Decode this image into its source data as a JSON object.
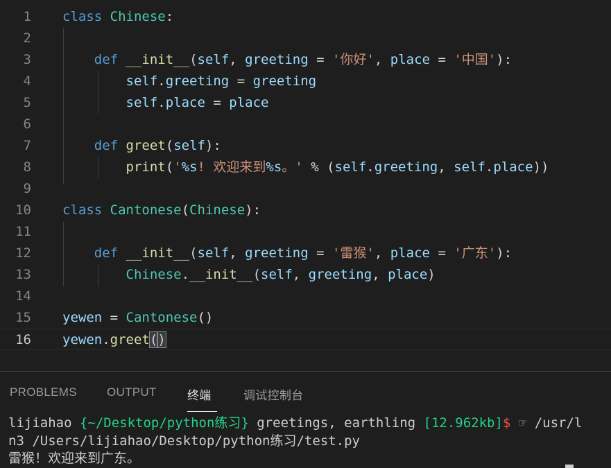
{
  "editor": {
    "lines": [
      {
        "num": "1",
        "tokens": [
          [
            "kw",
            "class"
          ],
          [
            "op",
            " "
          ],
          [
            "cls",
            "Chinese"
          ],
          [
            "op",
            ":"
          ]
        ]
      },
      {
        "num": "2",
        "tokens": []
      },
      {
        "num": "3",
        "tokens": [
          [
            "op",
            "    "
          ],
          [
            "kw",
            "def"
          ],
          [
            "op",
            " "
          ],
          [
            "fn",
            "__init__"
          ],
          [
            "op",
            "("
          ],
          [
            "var",
            "self"
          ],
          [
            "op",
            ", "
          ],
          [
            "var",
            "greeting"
          ],
          [
            "op",
            " = "
          ],
          [
            "str",
            "'你好'"
          ],
          [
            "op",
            ", "
          ],
          [
            "var",
            "place"
          ],
          [
            "op",
            " = "
          ],
          [
            "str",
            "'中国'"
          ],
          [
            "op",
            "):"
          ]
        ]
      },
      {
        "num": "4",
        "tokens": [
          [
            "op",
            "        "
          ],
          [
            "var",
            "self"
          ],
          [
            "op",
            "."
          ],
          [
            "var",
            "greeting"
          ],
          [
            "op",
            " = "
          ],
          [
            "var",
            "greeting"
          ]
        ]
      },
      {
        "num": "5",
        "tokens": [
          [
            "op",
            "        "
          ],
          [
            "var",
            "self"
          ],
          [
            "op",
            "."
          ],
          [
            "var",
            "place"
          ],
          [
            "op",
            " = "
          ],
          [
            "var",
            "place"
          ]
        ]
      },
      {
        "num": "6",
        "tokens": []
      },
      {
        "num": "7",
        "tokens": [
          [
            "op",
            "    "
          ],
          [
            "kw",
            "def"
          ],
          [
            "op",
            " "
          ],
          [
            "fn",
            "greet"
          ],
          [
            "op",
            "("
          ],
          [
            "var",
            "self"
          ],
          [
            "op",
            "):"
          ]
        ]
      },
      {
        "num": "8",
        "tokens": [
          [
            "op",
            "        "
          ],
          [
            "fn",
            "print"
          ],
          [
            "op",
            "("
          ],
          [
            "str",
            "'"
          ],
          [
            "fmt",
            "%s"
          ],
          [
            "str",
            "! 欢迎来到"
          ],
          [
            "fmt",
            "%s"
          ],
          [
            "str",
            "。'"
          ],
          [
            "op",
            " % ("
          ],
          [
            "var",
            "self"
          ],
          [
            "op",
            "."
          ],
          [
            "var",
            "greeting"
          ],
          [
            "op",
            ", "
          ],
          [
            "var",
            "self"
          ],
          [
            "op",
            "."
          ],
          [
            "var",
            "place"
          ],
          [
            "op",
            "))"
          ]
        ]
      },
      {
        "num": "9",
        "tokens": []
      },
      {
        "num": "10",
        "tokens": [
          [
            "kw",
            "class"
          ],
          [
            "op",
            " "
          ],
          [
            "cls",
            "Cantonese"
          ],
          [
            "op",
            "("
          ],
          [
            "cls",
            "Chinese"
          ],
          [
            "op",
            "):"
          ]
        ]
      },
      {
        "num": "11",
        "tokens": []
      },
      {
        "num": "12",
        "tokens": [
          [
            "op",
            "    "
          ],
          [
            "kw",
            "def"
          ],
          [
            "op",
            " "
          ],
          [
            "fn",
            "__init__"
          ],
          [
            "op",
            "("
          ],
          [
            "var",
            "self"
          ],
          [
            "op",
            ", "
          ],
          [
            "var",
            "greeting"
          ],
          [
            "op",
            " = "
          ],
          [
            "str",
            "'雷猴'"
          ],
          [
            "op",
            ", "
          ],
          [
            "var",
            "place"
          ],
          [
            "op",
            " = "
          ],
          [
            "str",
            "'广东'"
          ],
          [
            "op",
            "):"
          ]
        ]
      },
      {
        "num": "13",
        "tokens": [
          [
            "op",
            "        "
          ],
          [
            "cls",
            "Chinese"
          ],
          [
            "op",
            "."
          ],
          [
            "fn",
            "__init__"
          ],
          [
            "op",
            "("
          ],
          [
            "var",
            "self"
          ],
          [
            "op",
            ", "
          ],
          [
            "var",
            "greeting"
          ],
          [
            "op",
            ", "
          ],
          [
            "var",
            "place"
          ],
          [
            "op",
            ")"
          ]
        ]
      },
      {
        "num": "14",
        "tokens": []
      },
      {
        "num": "15",
        "tokens": [
          [
            "var",
            "yewen"
          ],
          [
            "op",
            " = "
          ],
          [
            "cls",
            "Cantonese"
          ],
          [
            "op",
            "()"
          ]
        ]
      },
      {
        "num": "16",
        "tokens": [
          [
            "var",
            "yewen"
          ],
          [
            "op",
            "."
          ],
          [
            "fn",
            "greet"
          ],
          [
            "bracket",
            "()"
          ]
        ]
      }
    ],
    "current_line": "16"
  },
  "panel": {
    "tabs": [
      {
        "label": "PROBLEMS",
        "active": false
      },
      {
        "label": "OUTPUT",
        "active": false
      },
      {
        "label": "终端",
        "active": true
      },
      {
        "label": "调试控制台",
        "active": false
      }
    ],
    "terminal": {
      "prompt_user": "lijiahao ",
      "prompt_dir": "{~/Desktop/python练习}",
      "prompt_msg": " greetings, earthling ",
      "prompt_size": "[12.962kb]",
      "prompt_symbol": "$",
      "command_tail": " ☞ /usr/l",
      "command_line2": "n3 /Users/lijiahao/Desktop/python练习/test.py",
      "output": "雷猴！欢迎来到广东。"
    }
  },
  "colors": {
    "background": "#1e1e1e",
    "keyword": "#569cd6",
    "class_name": "#4ec9b0",
    "function": "#dcdcaa",
    "variable": "#9cdcfe",
    "string": "#ce9178",
    "terminal_green": "#23d18b",
    "terminal_red": "#f14c4c"
  }
}
